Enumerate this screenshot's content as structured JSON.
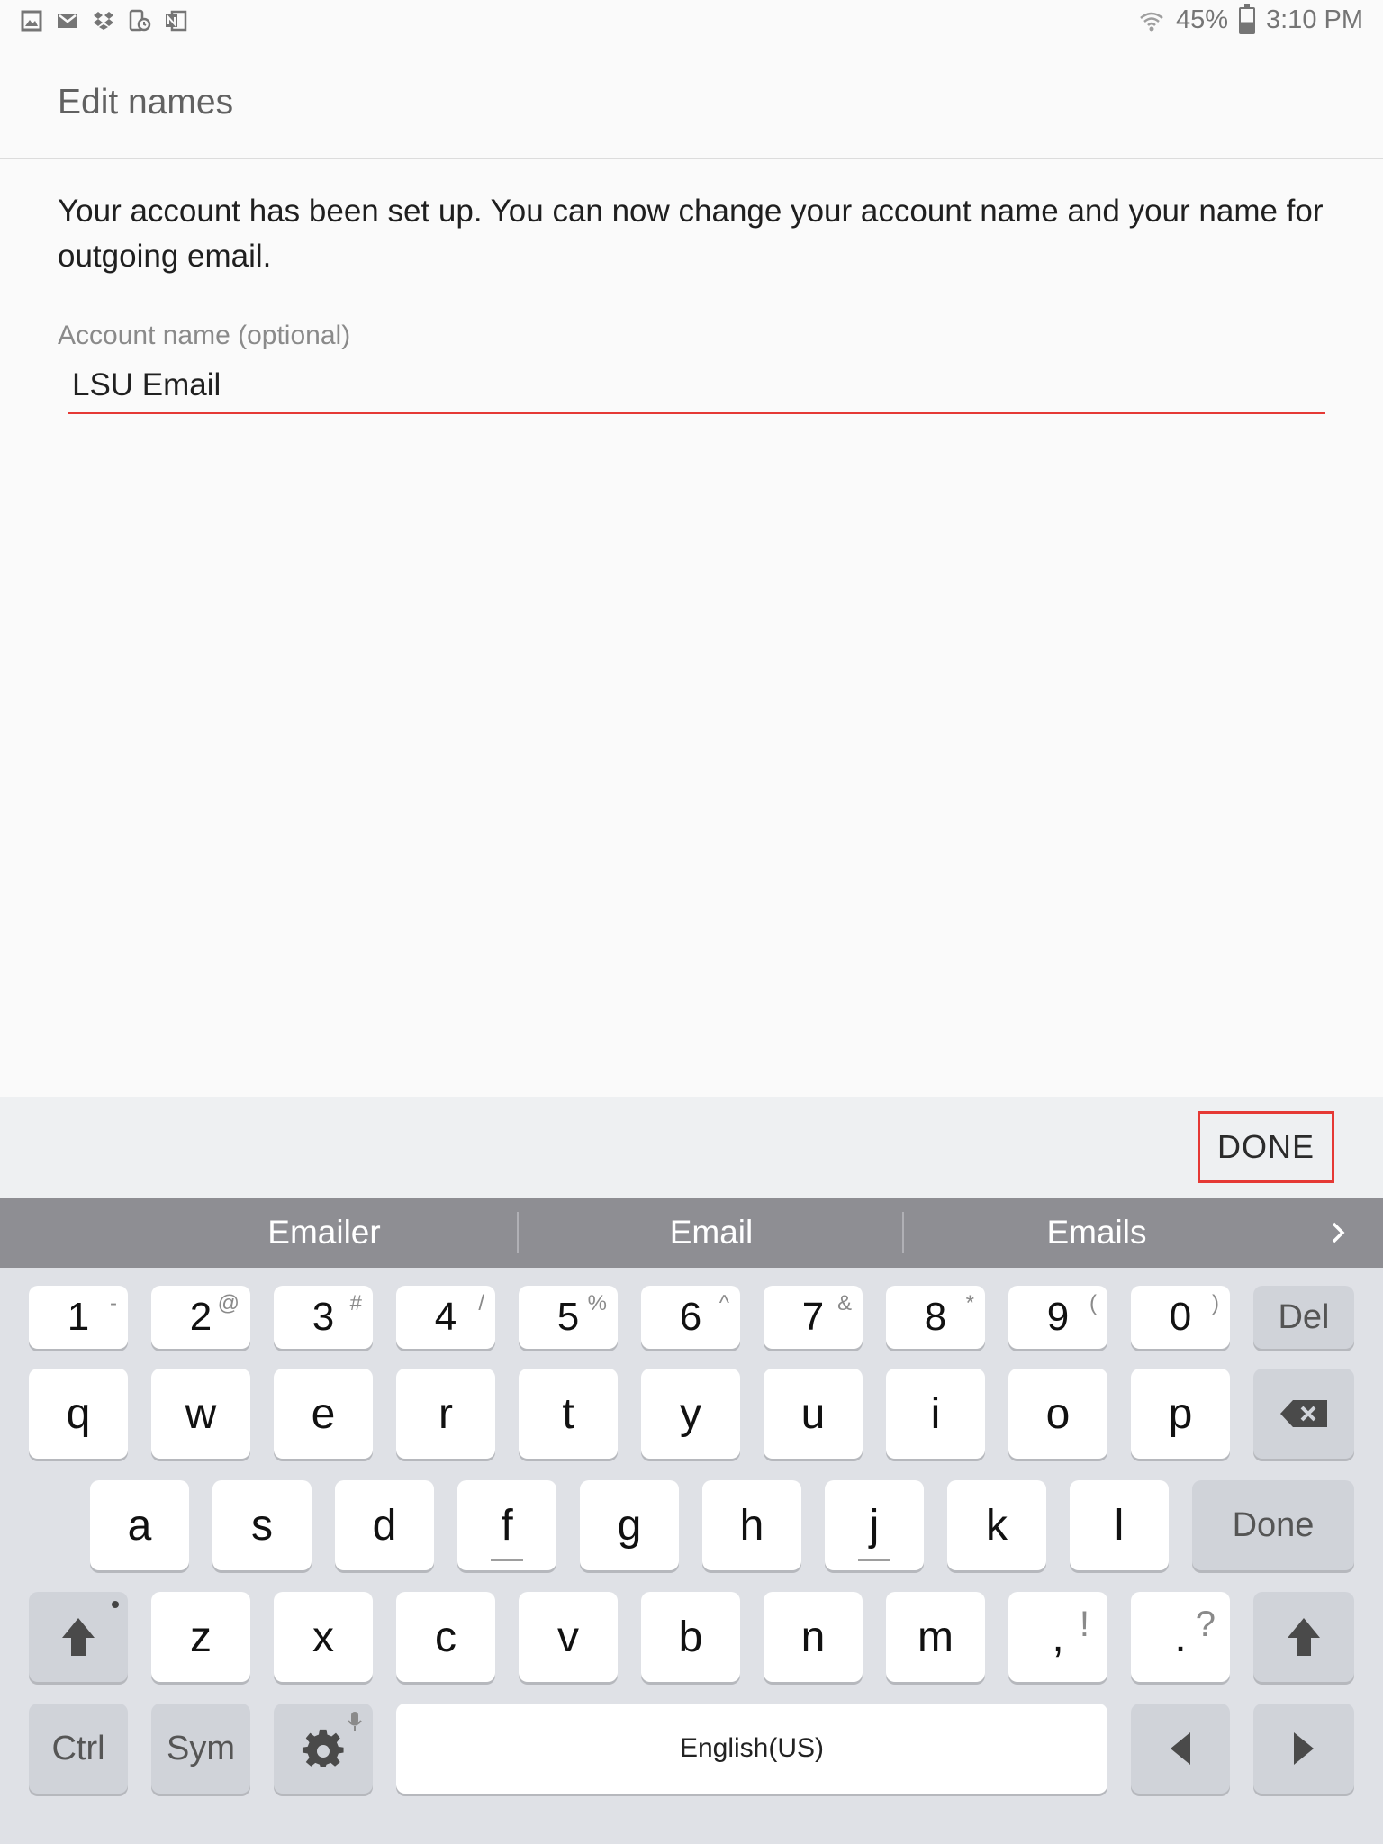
{
  "status": {
    "left_icons": [
      "gallery-icon",
      "gmail-icon",
      "dropbox-icon",
      "device-clock-icon",
      "onenote-icon"
    ],
    "battery": "45%",
    "time": "3:10 PM"
  },
  "header": {
    "title": "Edit names"
  },
  "content": {
    "description": "Your account has been set up. You can now change your account name and your name for outgoing email.",
    "field_label": "Account name (optional)",
    "field_value": "LSU Email"
  },
  "done_bar": {
    "done_label": "DONE"
  },
  "suggestions": [
    "Emailer",
    "Email",
    "Emails"
  ],
  "keyboard": {
    "num_row": [
      {
        "main": "1",
        "sup": "-"
      },
      {
        "main": "2",
        "sup": "@"
      },
      {
        "main": "3",
        "sup": "#"
      },
      {
        "main": "4",
        "sup": "/"
      },
      {
        "main": "5",
        "sup": "%"
      },
      {
        "main": "6",
        "sup": "^"
      },
      {
        "main": "7",
        "sup": "&"
      },
      {
        "main": "8",
        "sup": "*"
      },
      {
        "main": "9",
        "sup": "("
      },
      {
        "main": "0",
        "sup": ")"
      }
    ],
    "del_label": "Del",
    "row1": [
      "q",
      "w",
      "e",
      "r",
      "t",
      "y",
      "u",
      "i",
      "o",
      "p"
    ],
    "row2": [
      "a",
      "s",
      "d",
      "f",
      "g",
      "h",
      "j",
      "k",
      "l"
    ],
    "done_label": "Done",
    "row3": [
      "z",
      "x",
      "c",
      "v",
      "b",
      "n",
      "m"
    ],
    "comma": {
      "main": ",",
      "sup": "!"
    },
    "period": {
      "main": ".",
      "sup": "?"
    },
    "ctrl_label": "Ctrl",
    "sym_label": "Sym",
    "space_label": "English(US)"
  }
}
